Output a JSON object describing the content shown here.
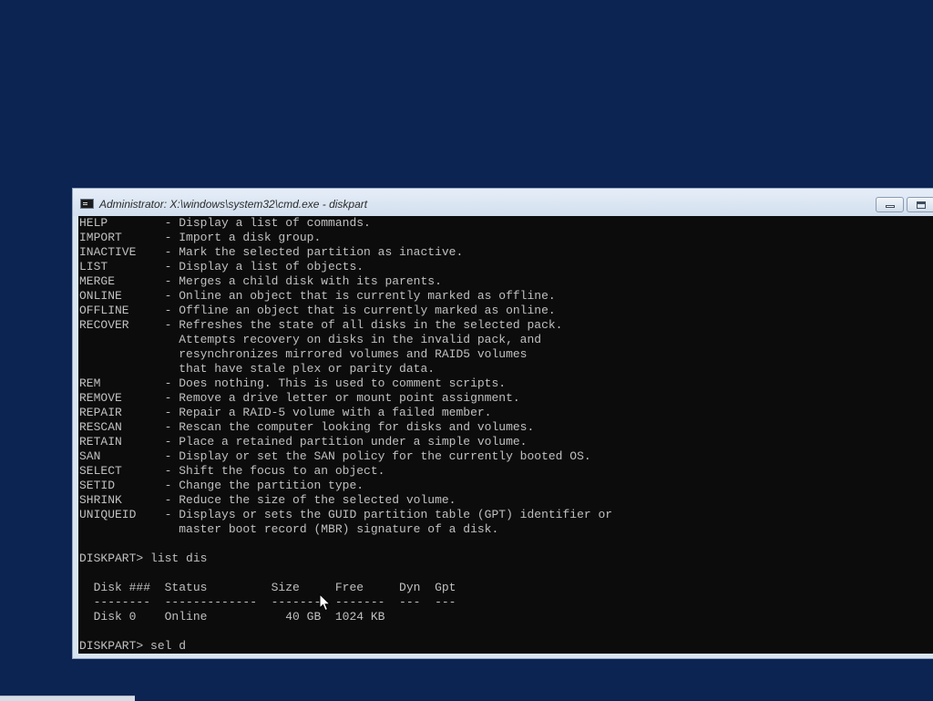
{
  "window": {
    "title": "Administrator: X:\\windows\\system32\\cmd.exe - diskpart",
    "icon": "command-prompt-icon"
  },
  "console": {
    "lines": [
      "HELP        - Display a list of commands.",
      "IMPORT      - Import a disk group.",
      "INACTIVE    - Mark the selected partition as inactive.",
      "LIST        - Display a list of objects.",
      "MERGE       - Merges a child disk with its parents.",
      "ONLINE      - Online an object that is currently marked as offline.",
      "OFFLINE     - Offline an object that is currently marked as online.",
      "RECOVER     - Refreshes the state of all disks in the selected pack.",
      "              Attempts recovery on disks in the invalid pack, and",
      "              resynchronizes mirrored volumes and RAID5 volumes",
      "              that have stale plex or parity data.",
      "REM         - Does nothing. This is used to comment scripts.",
      "REMOVE      - Remove a drive letter or mount point assignment.",
      "REPAIR      - Repair a RAID-5 volume with a failed member.",
      "RESCAN      - Rescan the computer looking for disks and volumes.",
      "RETAIN      - Place a retained partition under a simple volume.",
      "SAN         - Display or set the SAN policy for the currently booted OS.",
      "SELECT      - Shift the focus to an object.",
      "SETID       - Change the partition type.",
      "SHRINK      - Reduce the size of the selected volume.",
      "UNIQUEID    - Displays or sets the GUID partition table (GPT) identifier or",
      "              master boot record (MBR) signature of a disk.",
      "",
      "DISKPART> list dis",
      "",
      "  Disk ###  Status         Size     Free     Dyn  Gpt",
      "  --------  -------------  -------  -------  ---  ---",
      "  Disk 0    Online           40 GB  1024 KB",
      "",
      "DISKPART> sel d"
    ]
  },
  "colors": {
    "desktop": "#0b2452",
    "console_bg": "#0c0c0c",
    "console_fg": "#c0c0c0",
    "titlebar": "#d9e4f1"
  }
}
